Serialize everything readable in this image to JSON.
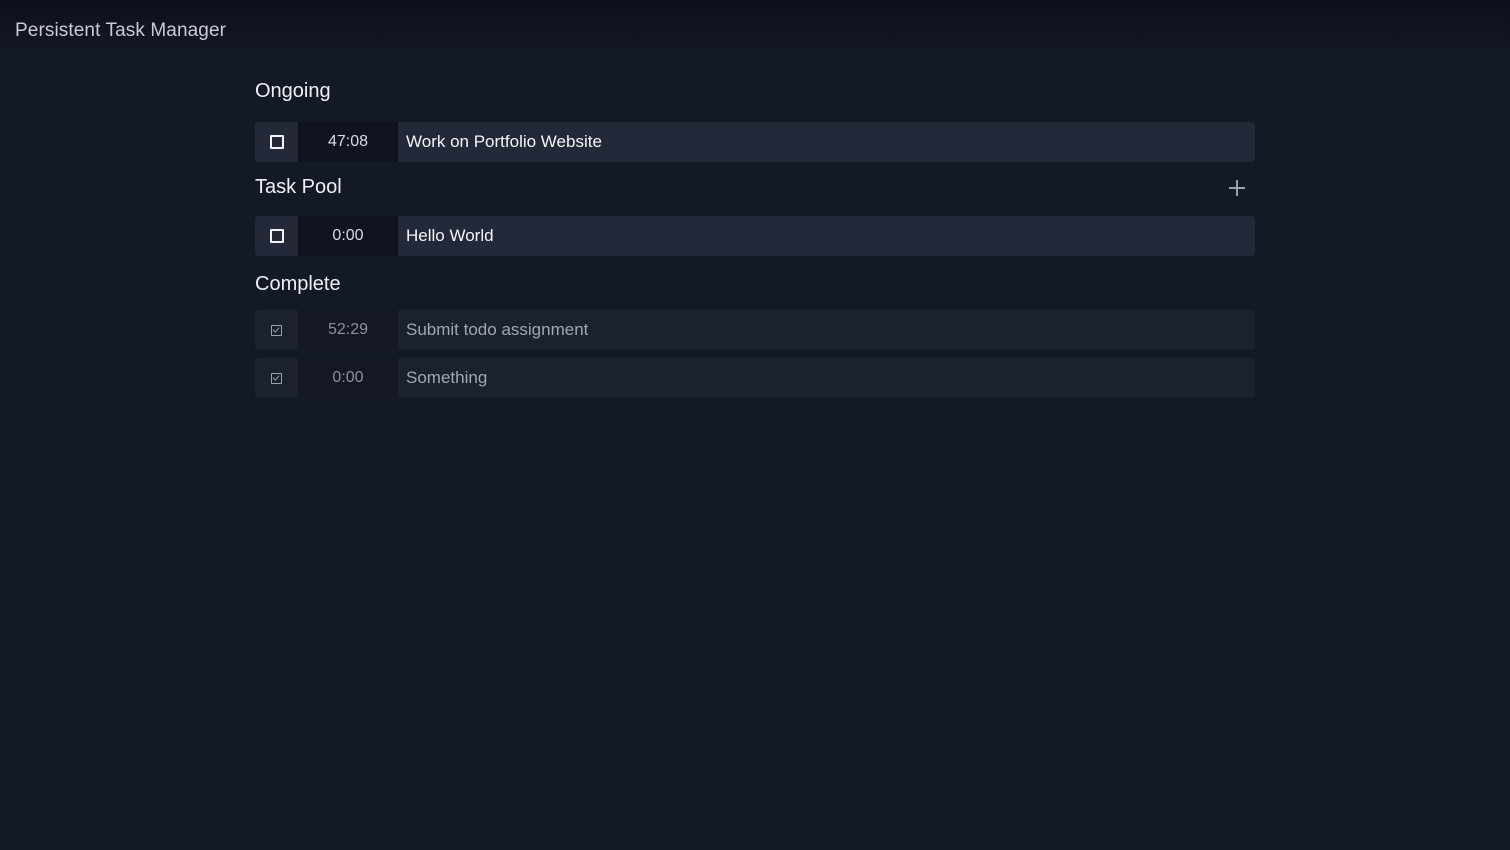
{
  "app": {
    "title": "Persistent Task Manager"
  },
  "sections": {
    "ongoing": {
      "title": "Ongoing",
      "tasks": [
        {
          "time": "47:08",
          "name": "Work on Portfolio Website",
          "complete": false
        }
      ]
    },
    "pool": {
      "title": "Task Pool",
      "add_icon": "plus-icon",
      "tasks": [
        {
          "time": "0:00",
          "name": "Hello World",
          "complete": false
        }
      ]
    },
    "complete": {
      "title": "Complete",
      "tasks": [
        {
          "time": "52:29",
          "name": "Submit todo assignment",
          "complete": true
        },
        {
          "time": "0:00",
          "name": "Something",
          "complete": true
        }
      ]
    }
  },
  "colors": {
    "background": "#141926",
    "row": "#232938",
    "time_cell": "#101420",
    "text": "#f4f5f8",
    "muted_text": "#a2a7b2"
  }
}
